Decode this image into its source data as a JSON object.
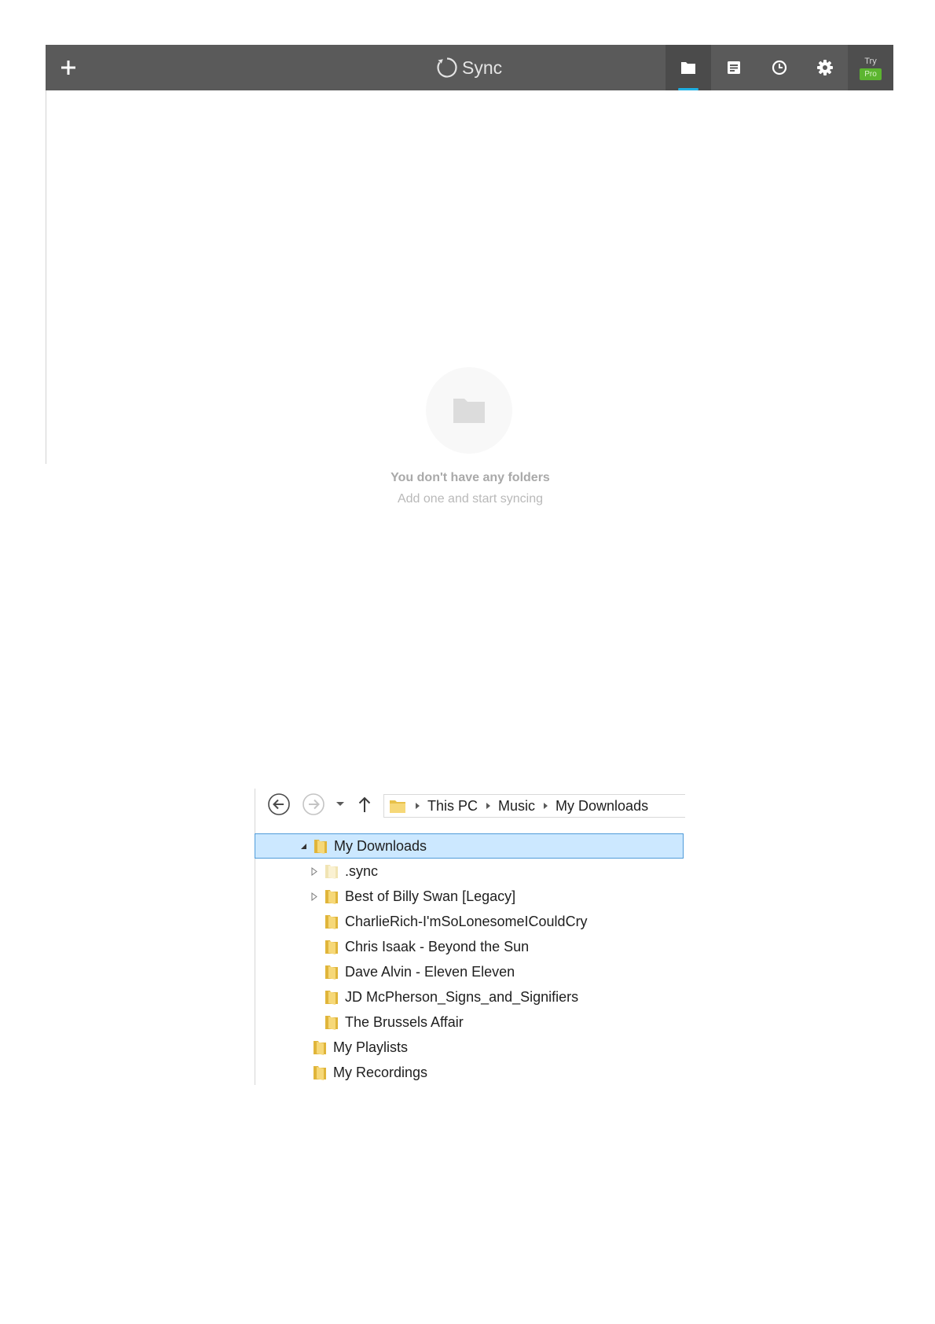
{
  "sync_app": {
    "title": "Sync",
    "toolbar": {
      "add_icon": "plus-icon",
      "buttons": [
        {
          "name": "folders",
          "icon": "folder-icon",
          "active": true
        },
        {
          "name": "transfers",
          "icon": "list-icon",
          "active": false
        },
        {
          "name": "history",
          "icon": "clock-icon",
          "active": false
        },
        {
          "name": "settings",
          "icon": "gear-icon",
          "active": false
        }
      ],
      "try_label": "Try",
      "pro_label": "Pro"
    },
    "empty_state": {
      "title": "You don't have any folders",
      "subtitle": "Add one and start syncing"
    },
    "colors": {
      "toolbar_bg": "#5a5a5a",
      "active_indicator": "#1fb1e4",
      "pro_badge": "#5cb530"
    }
  },
  "explorer": {
    "breadcrumb": [
      "This PC",
      "Music",
      "My Downloads"
    ],
    "tree": [
      {
        "label": "My Downloads",
        "level": 0,
        "expander": "expanded",
        "selected": true,
        "faded": false
      },
      {
        "label": ".sync",
        "level": 1,
        "expander": "collapsed",
        "selected": false,
        "faded": true
      },
      {
        "label": "Best of Billy Swan [Legacy]",
        "level": 1,
        "expander": "collapsed",
        "selected": false,
        "faded": false
      },
      {
        "label": "CharlieRich-I'mSoLonesomeICouldCry",
        "level": 1,
        "expander": "none",
        "selected": false,
        "faded": false
      },
      {
        "label": "Chris Isaak - Beyond the Sun",
        "level": 1,
        "expander": "none",
        "selected": false,
        "faded": false
      },
      {
        "label": "Dave Alvin - Eleven Eleven",
        "level": 1,
        "expander": "none",
        "selected": false,
        "faded": false
      },
      {
        "label": "JD McPherson_Signs_and_Signifiers",
        "level": 1,
        "expander": "none",
        "selected": false,
        "faded": false
      },
      {
        "label": "The Brussels Affair",
        "level": 1,
        "expander": "none",
        "selected": false,
        "faded": false
      },
      {
        "label": "My Playlists",
        "level": 0,
        "expander": "none",
        "selected": false,
        "faded": false
      },
      {
        "label": "My Recordings",
        "level": 0,
        "expander": "none",
        "selected": false,
        "faded": false
      }
    ],
    "colors": {
      "selection_bg": "#cce8ff",
      "selection_border": "#4f9bd9",
      "folder": "#e8c14a"
    }
  }
}
